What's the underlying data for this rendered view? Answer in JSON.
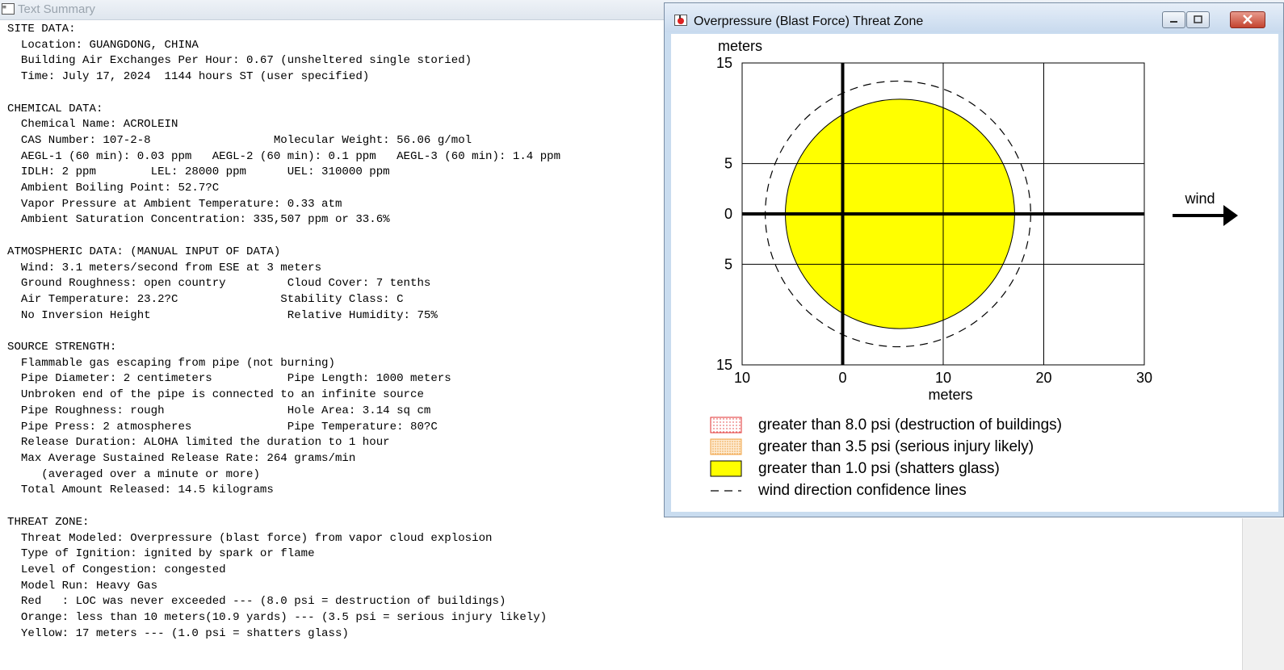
{
  "text_summary": {
    "title": "Text Summary",
    "lines": [
      "SITE DATA:",
      "  Location: GUANGDONG, CHINA",
      "  Building Air Exchanges Per Hour: 0.67 (unsheltered single storied)",
      "  Time: July 17, 2024  1144 hours ST (user specified)",
      "",
      "CHEMICAL DATA:",
      "  Chemical Name: ACROLEIN",
      "  CAS Number: 107-2-8                  Molecular Weight: 56.06 g/mol",
      "  AEGL-1 (60 min): 0.03 ppm   AEGL-2 (60 min): 0.1 ppm   AEGL-3 (60 min): 1.4 ppm",
      "  IDLH: 2 ppm        LEL: 28000 ppm      UEL: 310000 ppm",
      "  Ambient Boiling Point: 52.7?C",
      "  Vapor Pressure at Ambient Temperature: 0.33 atm",
      "  Ambient Saturation Concentration: 335,507 ppm or 33.6%",
      "",
      "ATMOSPHERIC DATA: (MANUAL INPUT OF DATA)",
      "  Wind: 3.1 meters/second from ESE at 3 meters",
      "  Ground Roughness: open country         Cloud Cover: 7 tenths",
      "  Air Temperature: 23.2?C               Stability Class: C",
      "  No Inversion Height                    Relative Humidity: 75%",
      "",
      "SOURCE STRENGTH:",
      "  Flammable gas escaping from pipe (not burning)",
      "  Pipe Diameter: 2 centimeters           Pipe Length: 1000 meters",
      "  Unbroken end of the pipe is connected to an infinite source",
      "  Pipe Roughness: rough                  Hole Area: 3.14 sq cm",
      "  Pipe Press: 2 atmospheres              Pipe Temperature: 80?C",
      "  Release Duration: ALOHA limited the duration to 1 hour",
      "  Max Average Sustained Release Rate: 264 grams/min",
      "     (averaged over a minute or more)",
      "  Total Amount Released: 14.5 kilograms",
      "",
      "THREAT ZONE:",
      "  Threat Modeled: Overpressure (blast force) from vapor cloud explosion",
      "  Type of Ignition: ignited by spark or flame",
      "  Level of Congestion: congested",
      "  Model Run: Heavy Gas",
      "  Red   : LOC was never exceeded --- (8.0 psi = destruction of buildings)",
      "  Orange: less than 10 meters(10.9 yards) --- (3.5 psi = serious injury likely)",
      "  Yellow: 17 meters --- (1.0 psi = shatters glass)"
    ]
  },
  "threat_window": {
    "title": "Overpressure (Blast Force) Threat Zone",
    "chart_data": {
      "type": "threat-zone-plot",
      "y_unit_label": "meters",
      "x_unit_label": "meters",
      "x_ticks": [
        {
          "value": -10,
          "label": "10"
        },
        {
          "value": 0,
          "label": "0"
        },
        {
          "value": 10,
          "label": "10"
        },
        {
          "value": 20,
          "label": "20"
        },
        {
          "value": 30,
          "label": "30"
        }
      ],
      "y_ticks": [
        {
          "value": 15,
          "label": "15"
        },
        {
          "value": 5,
          "label": "5"
        },
        {
          "value": 0,
          "label": "0"
        },
        {
          "value": -5,
          "label": "5"
        },
        {
          "value": -15,
          "label": "15"
        }
      ],
      "xlim": [
        -10,
        30
      ],
      "ylim": [
        -15,
        15
      ],
      "grid": true,
      "zones": [
        {
          "name": "yellow",
          "center_x": 5.7,
          "center_y": 0,
          "radius": 11.4,
          "color": "#ffff00"
        }
      ],
      "confidence_circle": {
        "center_x": 5.5,
        "center_y": 0,
        "radius": 13.2
      },
      "wind_label": "wind",
      "legend": [
        {
          "label": "greater than 8.0 psi (destruction of buildings)",
          "swatch": "red-dotted"
        },
        {
          "label": "greater than 3.5 psi (serious injury likely)",
          "swatch": "orange-dotted"
        },
        {
          "label": "greater than 1.0 psi (shatters glass)",
          "swatch": "yellow-solid"
        },
        {
          "label": "wind direction confidence lines",
          "swatch": "dashed-line"
        }
      ]
    }
  },
  "colors": {
    "yellow_zone": "#ffff00",
    "red_swatch": "#e03030",
    "orange_swatch": "#f0a040"
  }
}
